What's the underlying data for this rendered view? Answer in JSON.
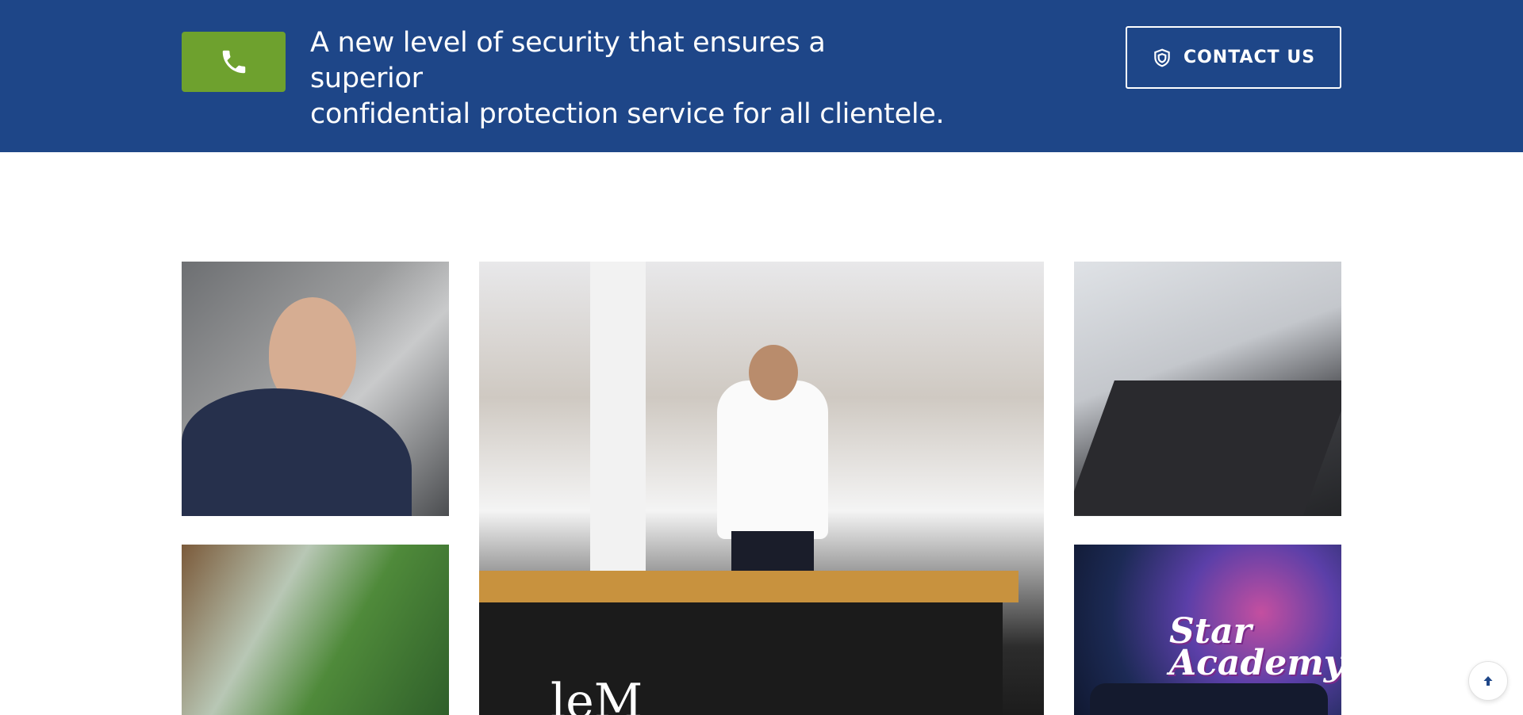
{
  "cta": {
    "tagline_line1": "A new level of security that ensures a superior",
    "tagline_line2": "confidential protection service for all clientele.",
    "contact_label": "CONTACT US",
    "phone_icon": "phone-icon",
    "shield_icon": "shield-icon",
    "band_color": "#1e4688",
    "accent_color": "#6ea12e"
  },
  "gallery": {
    "tiles": [
      {
        "name": "guard-portrait-photo"
      },
      {
        "name": "mall-guard-photo",
        "sign_text": "leM"
      },
      {
        "name": "conference-room-photo"
      },
      {
        "name": "entrance-screening-photo"
      },
      {
        "name": "star-academy-team-photo",
        "logo_text": "Star Academy"
      }
    ]
  },
  "back_to_top": {
    "icon": "arrow-up-icon"
  }
}
